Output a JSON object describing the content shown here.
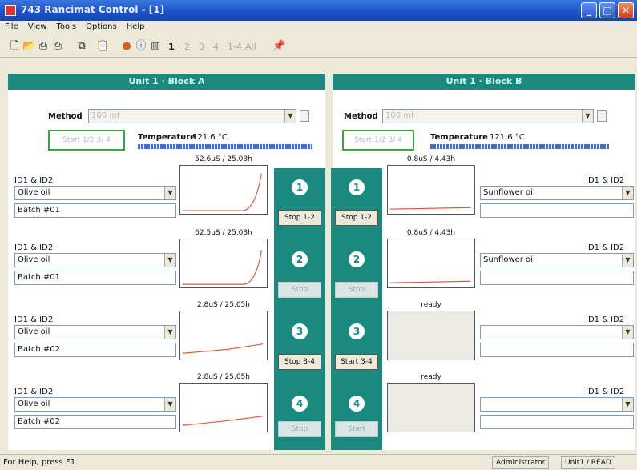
{
  "window": {
    "title": "743 Rancimat Control - [1]",
    "minimize": "_",
    "maximize": "□",
    "close": "✕"
  },
  "menu": [
    "File",
    "View",
    "Tools",
    "Options",
    "Help"
  ],
  "toolbar": {
    "icons": [
      "new-icon",
      "open-icon",
      "print-icon",
      "print-preview-icon",
      "copy-icon",
      "paste-icon",
      "record-icon",
      "info-icon",
      "chart-icon"
    ],
    "numbers": [
      "1",
      "2",
      "3",
      "4",
      "1-4",
      "All"
    ],
    "pin_icon": "pin-icon"
  },
  "blockA": {
    "header": "Unit 1 · Block A",
    "method_label": "Method",
    "method_value": "100 ml",
    "start_button": "Start 1/2 3/ 4",
    "temperature_label": "Temperature",
    "temperature_value": "121.6 °C",
    "channels": [
      {
        "id_label": "ID1 & ID2",
        "sample": "Olive oil",
        "batch": "Batch #01",
        "graph_label": "52.6uS / 25.03h"
      },
      {
        "id_label": "ID1 & ID2",
        "sample": "Olive oil",
        "batch": "Batch #01",
        "graph_label": "62.5uS / 25.03h"
      },
      {
        "id_label": "ID1 & ID2",
        "sample": "Olive oil",
        "batch": "Batch #02",
        "graph_label": "2.8uS / 25.05h"
      },
      {
        "id_label": "ID1 & ID2",
        "sample": "Olive oil",
        "batch": "Batch #02",
        "graph_label": "2.8uS / 25.05h"
      }
    ],
    "steps": [
      {
        "number": "1",
        "button": "Stop 1-2"
      },
      {
        "number": "2",
        "button": "Stop"
      },
      {
        "number": "3",
        "button": "Stop 3-4"
      },
      {
        "number": "4",
        "button": "Stop"
      }
    ]
  },
  "blockB": {
    "header": "Unit 1 · Block B",
    "method_label": "Method",
    "method_value": "100 ml",
    "start_button": "Start 1/2 3/ 4",
    "temperature_label": "Temperature",
    "temperature_value": "121.6 °C",
    "channels": [
      {
        "id_label": "ID1 & ID2",
        "sample": "Sunflower oil",
        "batch": "",
        "graph_label": "0.8uS / 4.43h"
      },
      {
        "id_label": "ID1 & ID2",
        "sample": "Sunflower oil",
        "batch": "",
        "graph_label": "0.8uS / 4.43h"
      },
      {
        "id_label": "ID1 & ID2",
        "sample": "",
        "batch": "",
        "graph_label": "ready"
      },
      {
        "id_label": "ID1 & ID2",
        "sample": "",
        "batch": "",
        "graph_label": "ready"
      }
    ],
    "steps": [
      {
        "number": "1",
        "button": "Stop 1-2"
      },
      {
        "number": "2",
        "button": "Stop"
      },
      {
        "number": "3",
        "button": "Start 3-4"
      },
      {
        "number": "4",
        "button": "Start"
      }
    ]
  },
  "status": {
    "help": "For Help, press F1",
    "user": "Administrator",
    "unit": "Unit1 / READ"
  },
  "colors": {
    "accent": "#1a8a80",
    "curve": "#e0553a",
    "titlebar": "#1b4fc8"
  }
}
